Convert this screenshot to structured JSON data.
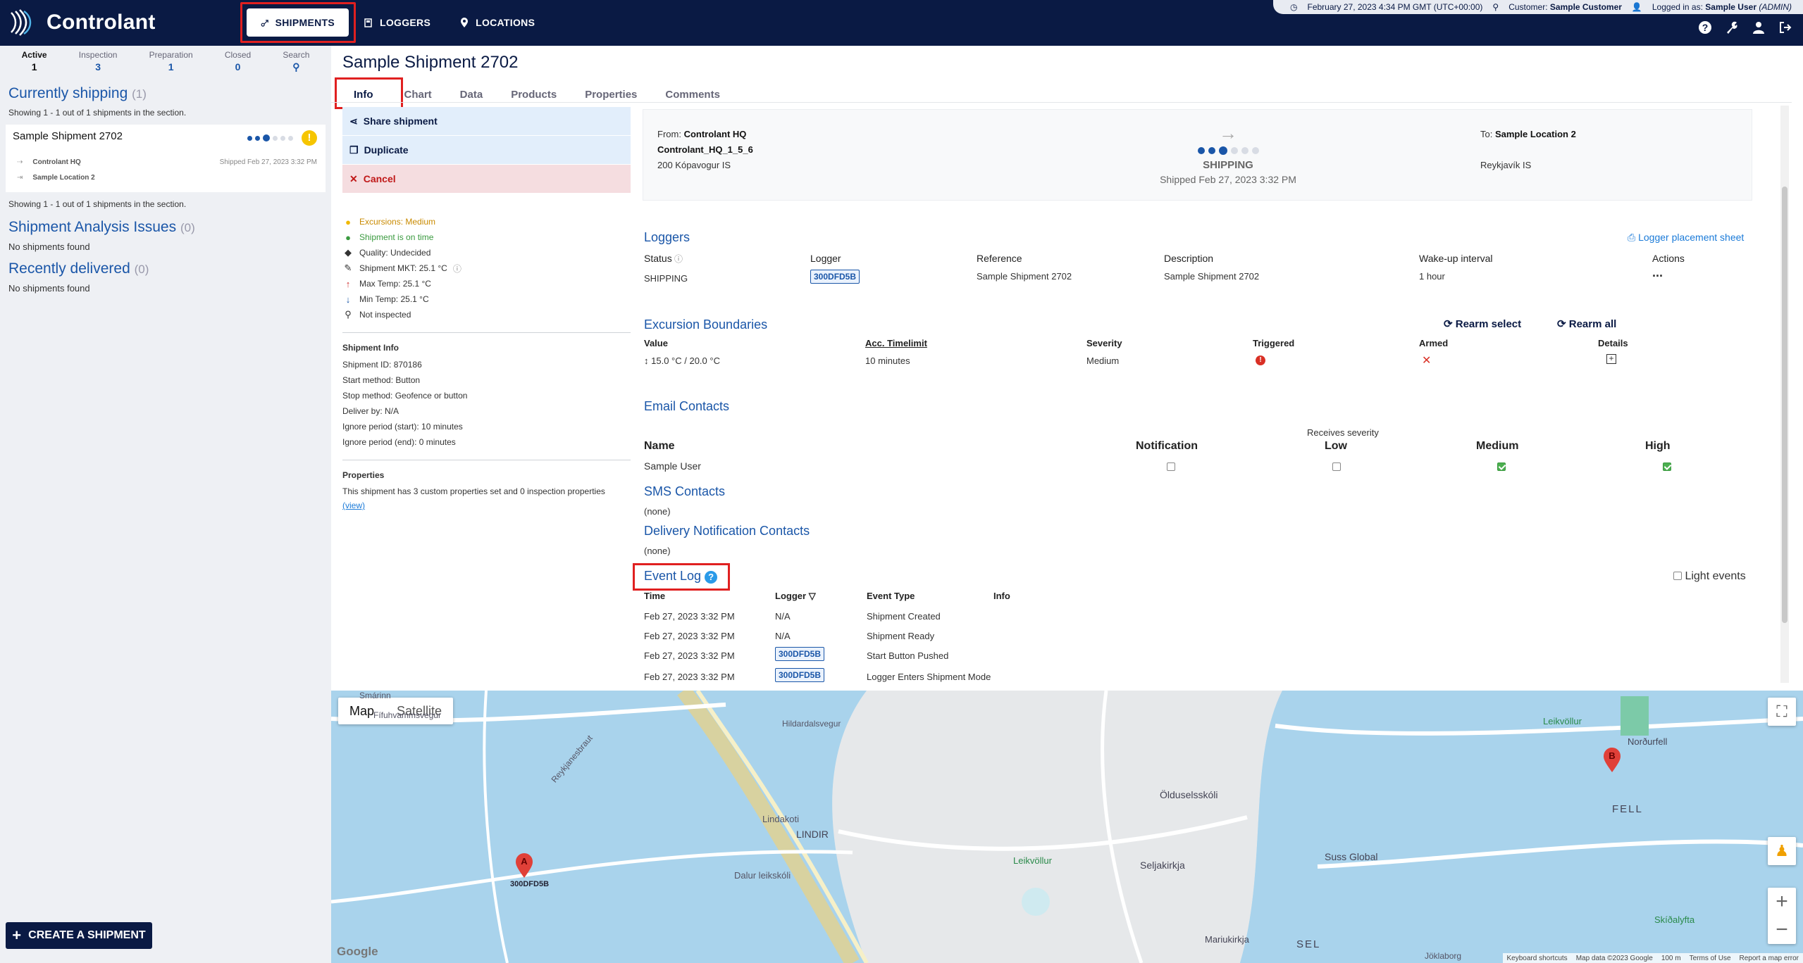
{
  "app": {
    "name": "Controlant"
  },
  "nav": {
    "shipments": "SHIPMENTS",
    "loggers": "LOGGERS",
    "locations": "LOCATIONS"
  },
  "status": {
    "datetime": "February 27, 2023 4:34 PM GMT (UTC+00:00)",
    "customer_label": "Customer:",
    "customer": "Sample Customer",
    "logged_label": "Logged in as:",
    "user": "Sample User",
    "role": "(ADMIN)"
  },
  "sidebar": {
    "tabs": [
      {
        "label": "Active",
        "count": "1"
      },
      {
        "label": "Inspection",
        "count": "3"
      },
      {
        "label": "Preparation",
        "count": "1"
      },
      {
        "label": "Closed",
        "count": "0"
      },
      {
        "label": "Search",
        "count": ""
      }
    ],
    "currently": {
      "title": "Currently shipping",
      "count": "(1)",
      "showing": "Showing 1 - 1 out of 1 shipments in the section.",
      "showing2": "Showing 1 - 1 out of 1 shipments in the section."
    },
    "card": {
      "name": "Sample Shipment 2702",
      "from": "Controlant HQ",
      "to": "Sample Location 2",
      "shipped": "Shipped Feb 27, 2023 3:32 PM",
      "warn": "!"
    },
    "analysis": {
      "title": "Shipment Analysis Issues",
      "count": "(0)",
      "empty": "No shipments found"
    },
    "delivered": {
      "title": "Recently delivered",
      "count": "(0)",
      "empty": "No shipments found"
    },
    "create": "CREATE A SHIPMENT"
  },
  "main": {
    "title": "Sample Shipment 2702",
    "tabs": [
      "Info",
      "Chart",
      "Data",
      "Products",
      "Properties",
      "Comments"
    ],
    "actions": {
      "share": "Share shipment",
      "duplicate": "Duplicate",
      "cancel": "Cancel"
    },
    "stats": [
      {
        "icon": "warning-icon",
        "text": "Excursions: Medium",
        "color": "#c98a00"
      },
      {
        "icon": "clock-icon",
        "text": "Shipment is on time",
        "color": "#3a9a3f"
      },
      {
        "icon": "tag-icon",
        "text": "Quality: Undecided",
        "color": "#333"
      },
      {
        "icon": "pen-icon",
        "text": "Shipment MKT: 25.1 °C",
        "color": "#333"
      },
      {
        "icon": "arrow-up-icon",
        "text": "Max Temp: 25.1 °C",
        "color": "#333"
      },
      {
        "icon": "arrow-down-icon",
        "text": "Min Temp: 25.1 °C",
        "color": "#333"
      },
      {
        "icon": "search-icon",
        "text": "Not inspected",
        "color": "#333"
      }
    ],
    "shipment_info": {
      "title": "Shipment Info",
      "lines": [
        "Shipment ID: 870186",
        "Start method: Button",
        "Stop method: Geofence or button",
        "Deliver by: N/A",
        "Ignore period (start): 10 minutes",
        "Ignore period (end): 0 minutes"
      ]
    },
    "properties": {
      "title": "Properties",
      "text": "This shipment has 3 custom properties set and 0 inspection properties",
      "link": "(view)"
    }
  },
  "shipcard": {
    "from_label": "From:",
    "from": "Controlant HQ",
    "from_sub": "Controlant_HQ_1_5_6",
    "from_addr": "200 Kópavogur IS",
    "status": "SHIPPING",
    "shipped": "Shipped Feb 27, 2023 3:32 PM",
    "to_label": "To:",
    "to": "Sample Location 2",
    "to_addr": "Reykjavík IS"
  },
  "loggers": {
    "title": "Loggers",
    "sheet": "Logger placement sheet",
    "headers": [
      "Status",
      "Logger",
      "Reference",
      "Description",
      "Wake-up interval",
      "Actions"
    ],
    "row": {
      "status": "SHIPPING",
      "logger": "300DFD5B",
      "reference": "Sample Shipment 2702",
      "description": "Sample Shipment 2702",
      "interval": "1 hour",
      "actions": "..."
    }
  },
  "excursion": {
    "title": "Excursion Boundaries",
    "rearm_select": "Rearm select",
    "rearm_all": "Rearm all",
    "headers": [
      "Value",
      "Acc. Timelimit",
      "Severity",
      "Triggered",
      "Armed",
      "Details"
    ],
    "row": {
      "value": "15.0 °C / 20.0 °C",
      "time": "10 minutes",
      "severity": "Medium"
    }
  },
  "email": {
    "title": "Email Contacts",
    "receives": "Receives severity",
    "headers": [
      "Name",
      "Notification",
      "Low",
      "Medium",
      "High"
    ],
    "row": {
      "name": "Sample User"
    }
  },
  "sms": {
    "title": "SMS Contacts",
    "none": "(none)"
  },
  "delivery": {
    "title": "Delivery Notification Contacts",
    "none": "(none)"
  },
  "eventlog": {
    "title": "Event Log",
    "light": "Light events",
    "headers": [
      "Time",
      "Logger",
      "Event Type",
      "Info"
    ],
    "rows": [
      {
        "time": "Feb 27, 2023 3:32 PM",
        "logger": "N/A",
        "chip": false,
        "type": "Shipment Created"
      },
      {
        "time": "Feb 27, 2023 3:32 PM",
        "logger": "N/A",
        "chip": false,
        "type": "Shipment Ready"
      },
      {
        "time": "Feb 27, 2023 3:32 PM",
        "logger": "300DFD5B",
        "chip": true,
        "type": "Start Button Pushed"
      },
      {
        "time": "Feb 27, 2023 3:32 PM",
        "logger": "300DFD5B",
        "chip": true,
        "type": "Logger Enters Shipment Mode"
      }
    ]
  },
  "map": {
    "tab_map": "Map",
    "tab_sat": "Satellite",
    "marker_a": "A",
    "marker_b": "B",
    "marker_label": "300DFD5B",
    "labels": [
      "Lindakoti",
      "LINDIR",
      "Dalur leikskóli",
      "Leikvöllur",
      "Seljakirkja",
      "Ölduselsskóli",
      "Suss Global",
      "Norðurfell",
      "FELL",
      "SEL",
      "Skíðalyfta",
      "Leikvöllur",
      "Fífuhvammsvegur",
      "Reykjanesbraut",
      "Smárinn",
      "Jöklaborg",
      "Hildardalsvegur",
      "Mariukirkja"
    ],
    "footer": [
      "Keyboard shortcuts",
      "Map data ©2023 Google",
      "100 m",
      "Terms of Use",
      "Report a map error"
    ],
    "google": "Google"
  }
}
